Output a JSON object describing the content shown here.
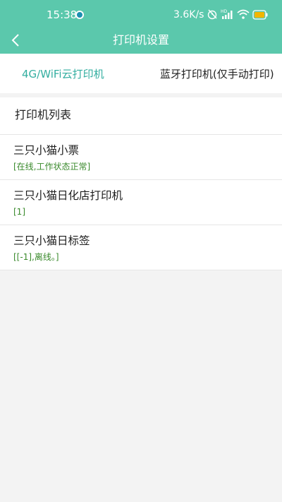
{
  "status_bar": {
    "time": "15:38",
    "network_speed": "3.6K/s",
    "icons": [
      "notification-dot-icon",
      "alarm-off-icon",
      "hd-signal-icon",
      "wifi-icon",
      "battery-icon"
    ]
  },
  "header": {
    "title": "打印机设置",
    "back_icon": "chevron-left-icon"
  },
  "tabs": [
    {
      "label": "4G/WiFi云打印机",
      "active": true
    },
    {
      "label": "蓝牙打印机(仅手动打印)",
      "active": false
    }
  ],
  "list": {
    "title": "打印机列表",
    "printers": [
      {
        "name": "三只小猫小票",
        "status": "[在线,工作状态正常]"
      },
      {
        "name": "三只小猫日化店打印机",
        "status": "[1]"
      },
      {
        "name": "三只小猫日标签",
        "status": "[[-1],离线。]"
      }
    ]
  },
  "colors": {
    "header_bg": "#5bc8ac",
    "tab_active": "#33aea0",
    "status_text": "#3a8a2c"
  }
}
